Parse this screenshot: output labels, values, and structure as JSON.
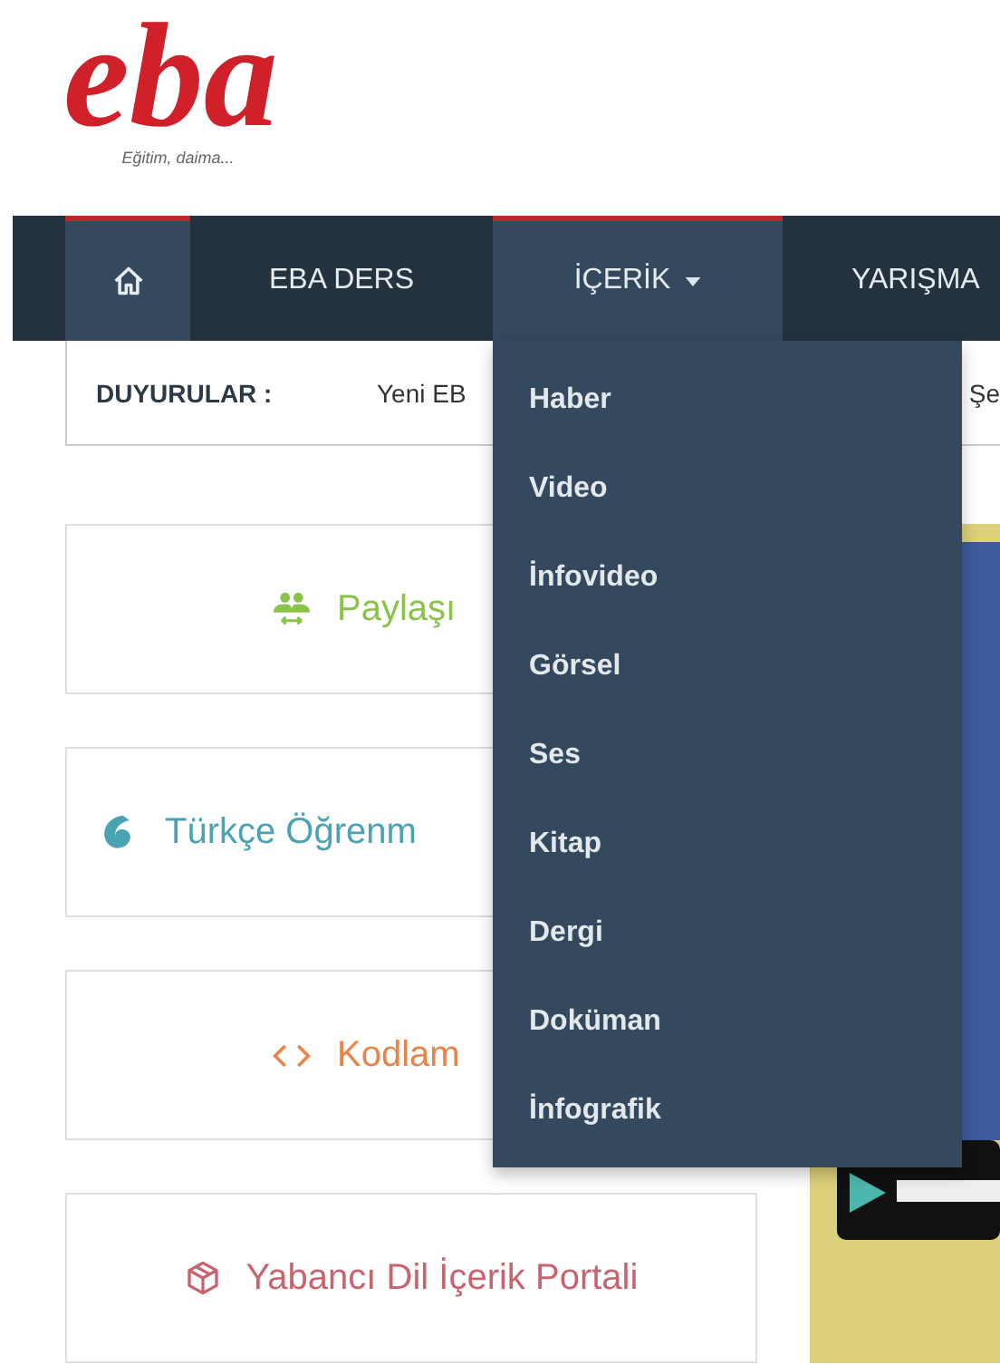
{
  "logo": {
    "wordmark": "eba",
    "tagline": "Eğitim, daima..."
  },
  "nav": {
    "items": [
      {
        "kind": "home",
        "active": true,
        "dropdown": false
      },
      {
        "kind": "text",
        "label": "EBA DERS",
        "active": false,
        "dropdown": false
      },
      {
        "kind": "text",
        "label": "İÇERİK",
        "active": true,
        "dropdown": true
      },
      {
        "kind": "text",
        "label": "YARIŞMA",
        "active": false,
        "dropdown": false
      }
    ]
  },
  "announcements": {
    "label": "DUYURULAR :",
    "texts": [
      "Yeni EB",
      "Şe"
    ]
  },
  "dropdown_menu": {
    "items": [
      "Haber",
      "Video",
      "İnfovideo",
      "Görsel",
      "Ses",
      "Kitap",
      "Dergi",
      "Doküman",
      "İnfografik"
    ]
  },
  "cards": [
    {
      "kind": "people",
      "label": "Paylaşı",
      "color": "#8bc34a"
    },
    {
      "kind": "swirl",
      "label": "Türkçe Öğrenm",
      "color": "#4aa3b3"
    },
    {
      "kind": "code",
      "label": "Kodlam",
      "color": "#e8834a"
    },
    {
      "kind": "cube",
      "label": "Yabancı Dil İçerik Portali",
      "color": "#c8646e"
    }
  ]
}
